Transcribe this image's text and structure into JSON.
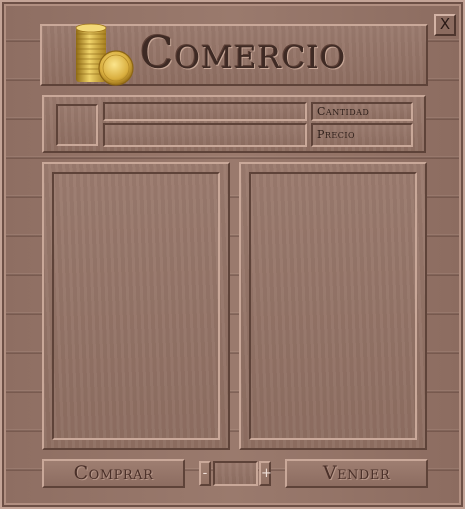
{
  "window": {
    "title": "Comercio",
    "close_label": "X"
  },
  "item_info": {
    "quantity_label": "Cantidad",
    "price_label": "Precio",
    "name_value": "",
    "description_value": "",
    "quantity_value": "",
    "price_value": ""
  },
  "actions": {
    "buy_label": "Comprar",
    "sell_label": "Vender",
    "minus_label": "-",
    "plus_label": "+",
    "amount_value": ""
  },
  "icons": {
    "title_icon": "coins-icon",
    "close_icon": "close-icon"
  }
}
